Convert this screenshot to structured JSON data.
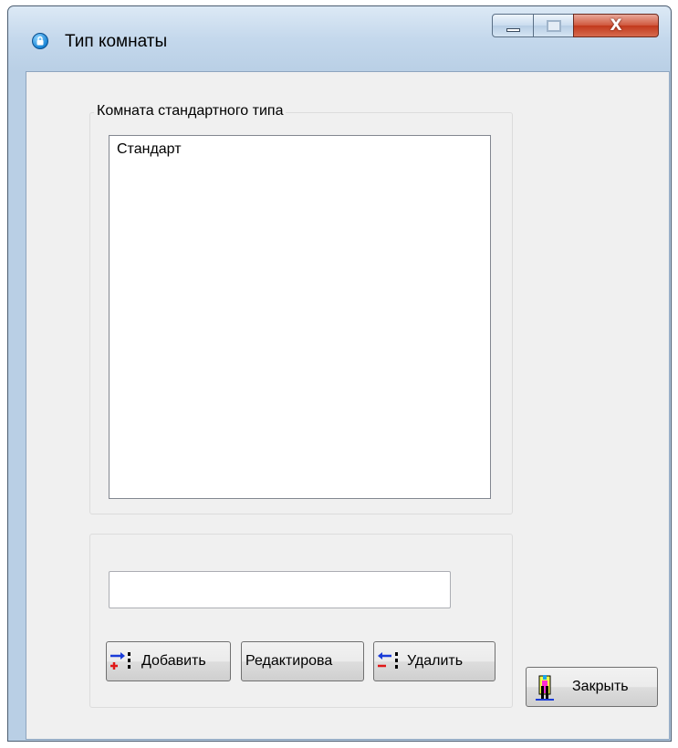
{
  "window": {
    "title": "Тип комнаты",
    "close_glyph": "X",
    "icons": {
      "app": "lock-icon"
    }
  },
  "group_room": {
    "legend": "Комната стандартного типа",
    "list_items": [
      "Стандарт"
    ]
  },
  "group_edit": {
    "input_value": ""
  },
  "buttons": {
    "add": {
      "label": "Добавить",
      "icon": "add-item-icon"
    },
    "edit": {
      "label": "Редактирова"
    },
    "delete": {
      "label": "Удалить",
      "icon": "remove-item-icon"
    },
    "close": {
      "label": "Закрыть",
      "icon": "exit-door-icon"
    }
  },
  "colors": {
    "title_bar": "#c4d8ec",
    "close_button": "#c2391c",
    "client_bg": "#f0f0f0"
  }
}
